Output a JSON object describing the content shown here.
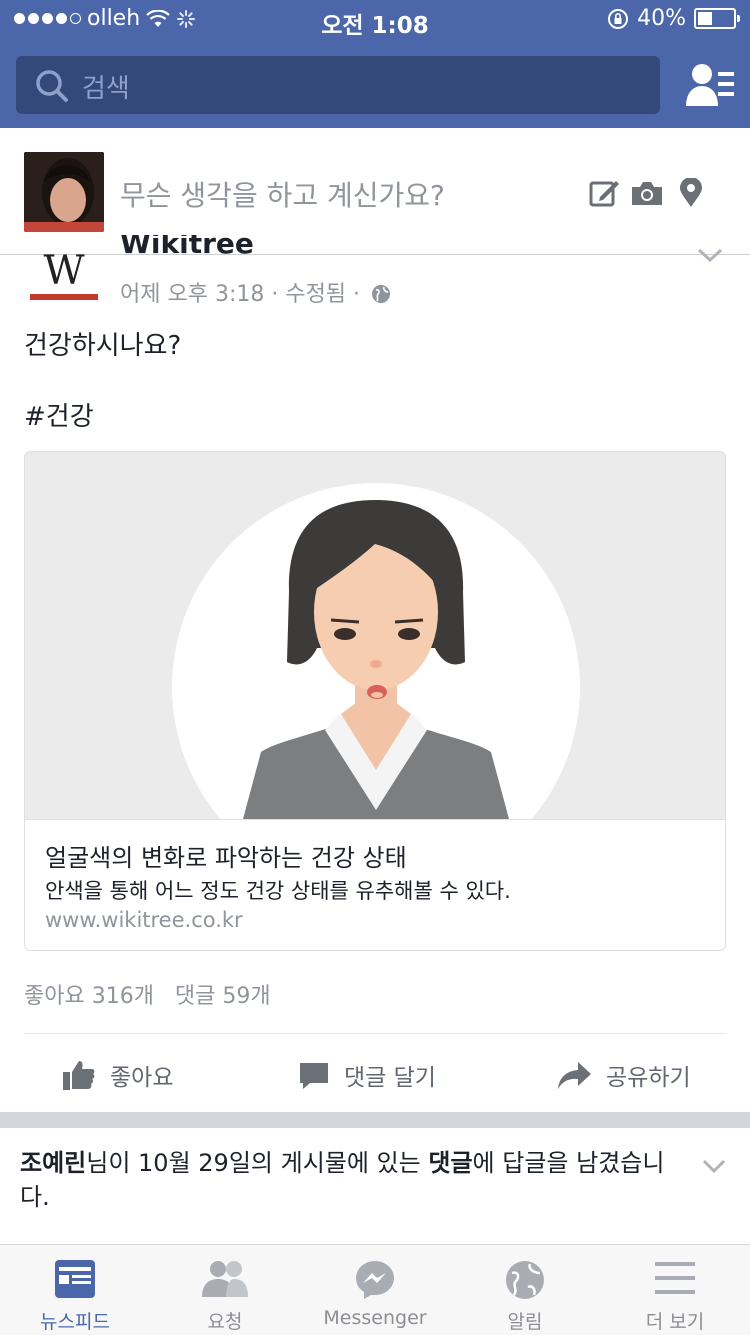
{
  "status": {
    "carrier": "olleh",
    "time": "오전 1:08",
    "battery": "40%",
    "battery_level": 0.4
  },
  "search": {
    "placeholder": "검색"
  },
  "composer": {
    "prompt": "무슨 생각을 하고 계신가요?"
  },
  "post": {
    "author": "Wikitree",
    "meta": "어제 오후 3:18 · 수정됨 ·",
    "text_lines": [
      "건강하시나요?",
      "#건강"
    ],
    "link": {
      "title": "얼굴색의 변화로 파악하는 건강 상태",
      "description": "안색을 통해 어느 정도 건강 상태를 유추해볼 수 있다.",
      "domain": "www.wikitree.co.kr"
    },
    "counts": "좋아요 316개   댓글 59개",
    "actions": {
      "like": "좋아요",
      "comment": "댓글 달기",
      "share": "공유하기"
    }
  },
  "notification": {
    "name": "조예린",
    "part1": "님이 10월 29일의 게시물에 있는 ",
    "highlight": "댓글",
    "part2": "에 답글을 남겼습니다."
  },
  "tabs": [
    {
      "label": "뉴스피드",
      "active": true
    },
    {
      "label": "요청",
      "active": false
    },
    {
      "label": "Messenger",
      "active": false
    },
    {
      "label": "알림",
      "active": false
    },
    {
      "label": "더 보기",
      "active": false
    }
  ],
  "colors": {
    "brand": "#4b67a9",
    "search_bg": "#34487a",
    "muted": "#90949c"
  }
}
